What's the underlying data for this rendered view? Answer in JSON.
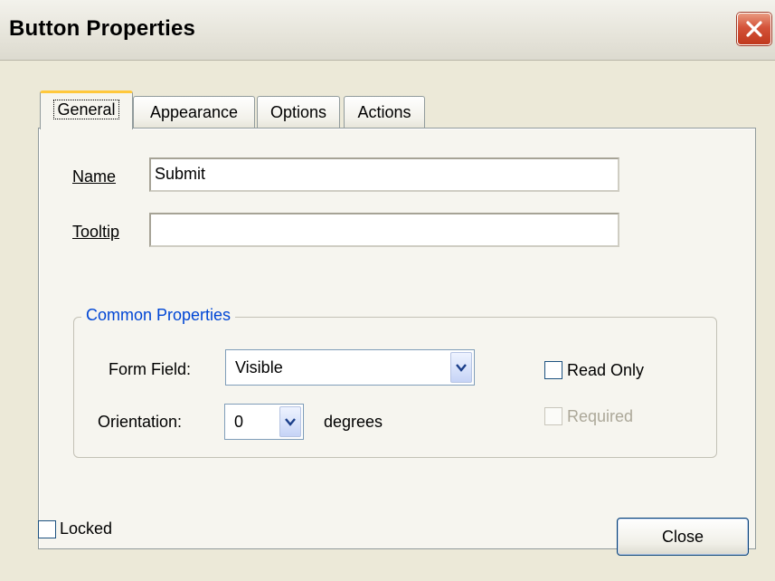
{
  "window": {
    "title": "Button Properties",
    "close_icon": "close-icon"
  },
  "tabs": [
    {
      "label": "General",
      "active": true
    },
    {
      "label": "Appearance",
      "active": false
    },
    {
      "label": "Options",
      "active": false
    },
    {
      "label": "Actions",
      "active": false
    }
  ],
  "general": {
    "name_label": "Name",
    "name_value": "Submit",
    "tooltip_label": "Tooltip",
    "tooltip_value": ""
  },
  "common_properties": {
    "title": "Common Properties",
    "form_field_label": "Form Field:",
    "form_field_value": "Visible",
    "orientation_label": "Orientation:",
    "orientation_value": "0",
    "orientation_unit": "degrees",
    "read_only_label": "Read Only",
    "read_only_checked": false,
    "required_label": "Required",
    "required_checked": false,
    "required_enabled": false
  },
  "footer": {
    "locked_label": "Locked",
    "locked_checked": false,
    "close_label": "Close"
  },
  "colors": {
    "group_title": "#0046d5",
    "active_tab_accent": "#ffc83c",
    "close_button_red": "#d4533a"
  }
}
